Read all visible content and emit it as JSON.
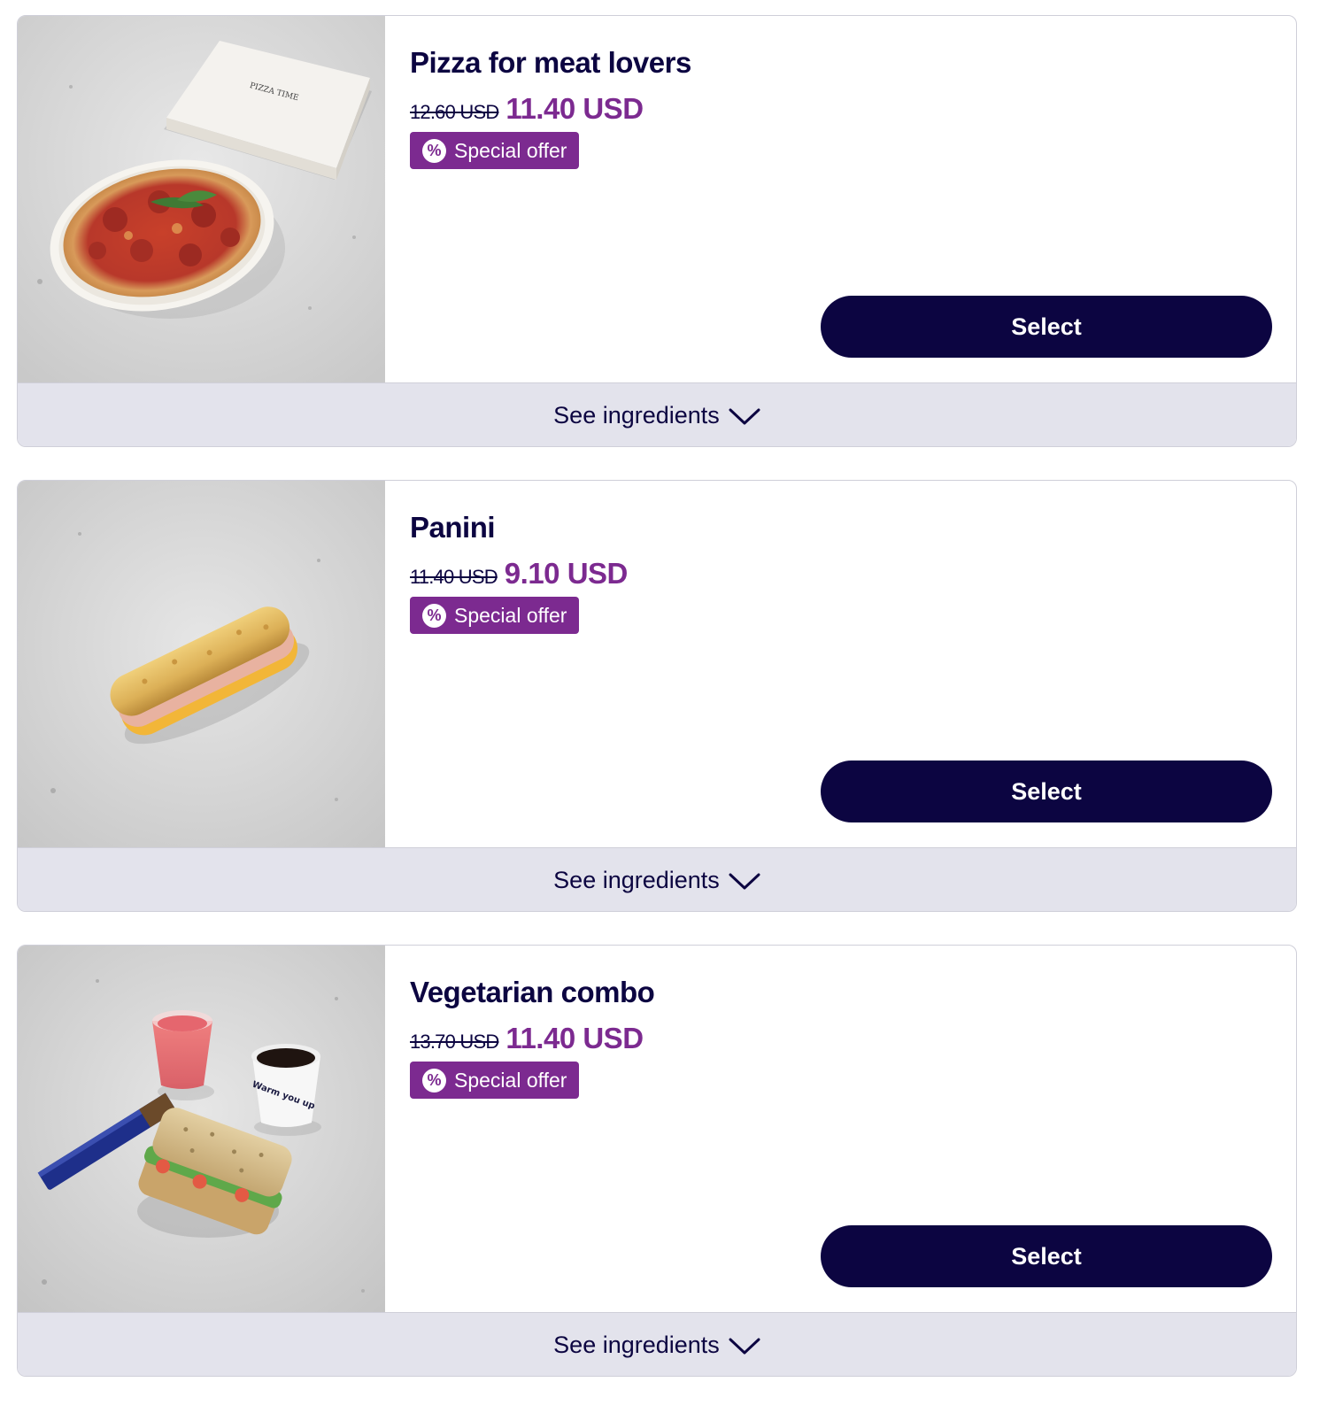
{
  "colors": {
    "brand_dark": "#0c0541",
    "offer_purple": "#7c2a90",
    "ingredients_bar": "#e3e3ec"
  },
  "products": [
    {
      "name": "Pizza for meat lovers",
      "old_price": "12.60 USD",
      "new_price": "11.40 USD",
      "badge_icon": "%",
      "badge_label": "Special offer",
      "select_label": "Select",
      "ingredients_label": "See ingredients",
      "image": "pizza-photo",
      "box_text": "PIZZA TIME"
    },
    {
      "name": "Panini",
      "old_price": "11.40 USD",
      "new_price": "9.10 USD",
      "badge_icon": "%",
      "badge_label": "Special offer",
      "select_label": "Select",
      "ingredients_label": "See ingredients",
      "image": "panini-photo"
    },
    {
      "name": "Vegetarian combo",
      "old_price": "13.70 USD",
      "new_price": "11.40 USD",
      "badge_icon": "%",
      "badge_label": "Special offer",
      "select_label": "Select",
      "ingredients_label": "See ingredients",
      "image": "vegetarian-combo-photo",
      "cup_text": "Warm you up"
    }
  ]
}
